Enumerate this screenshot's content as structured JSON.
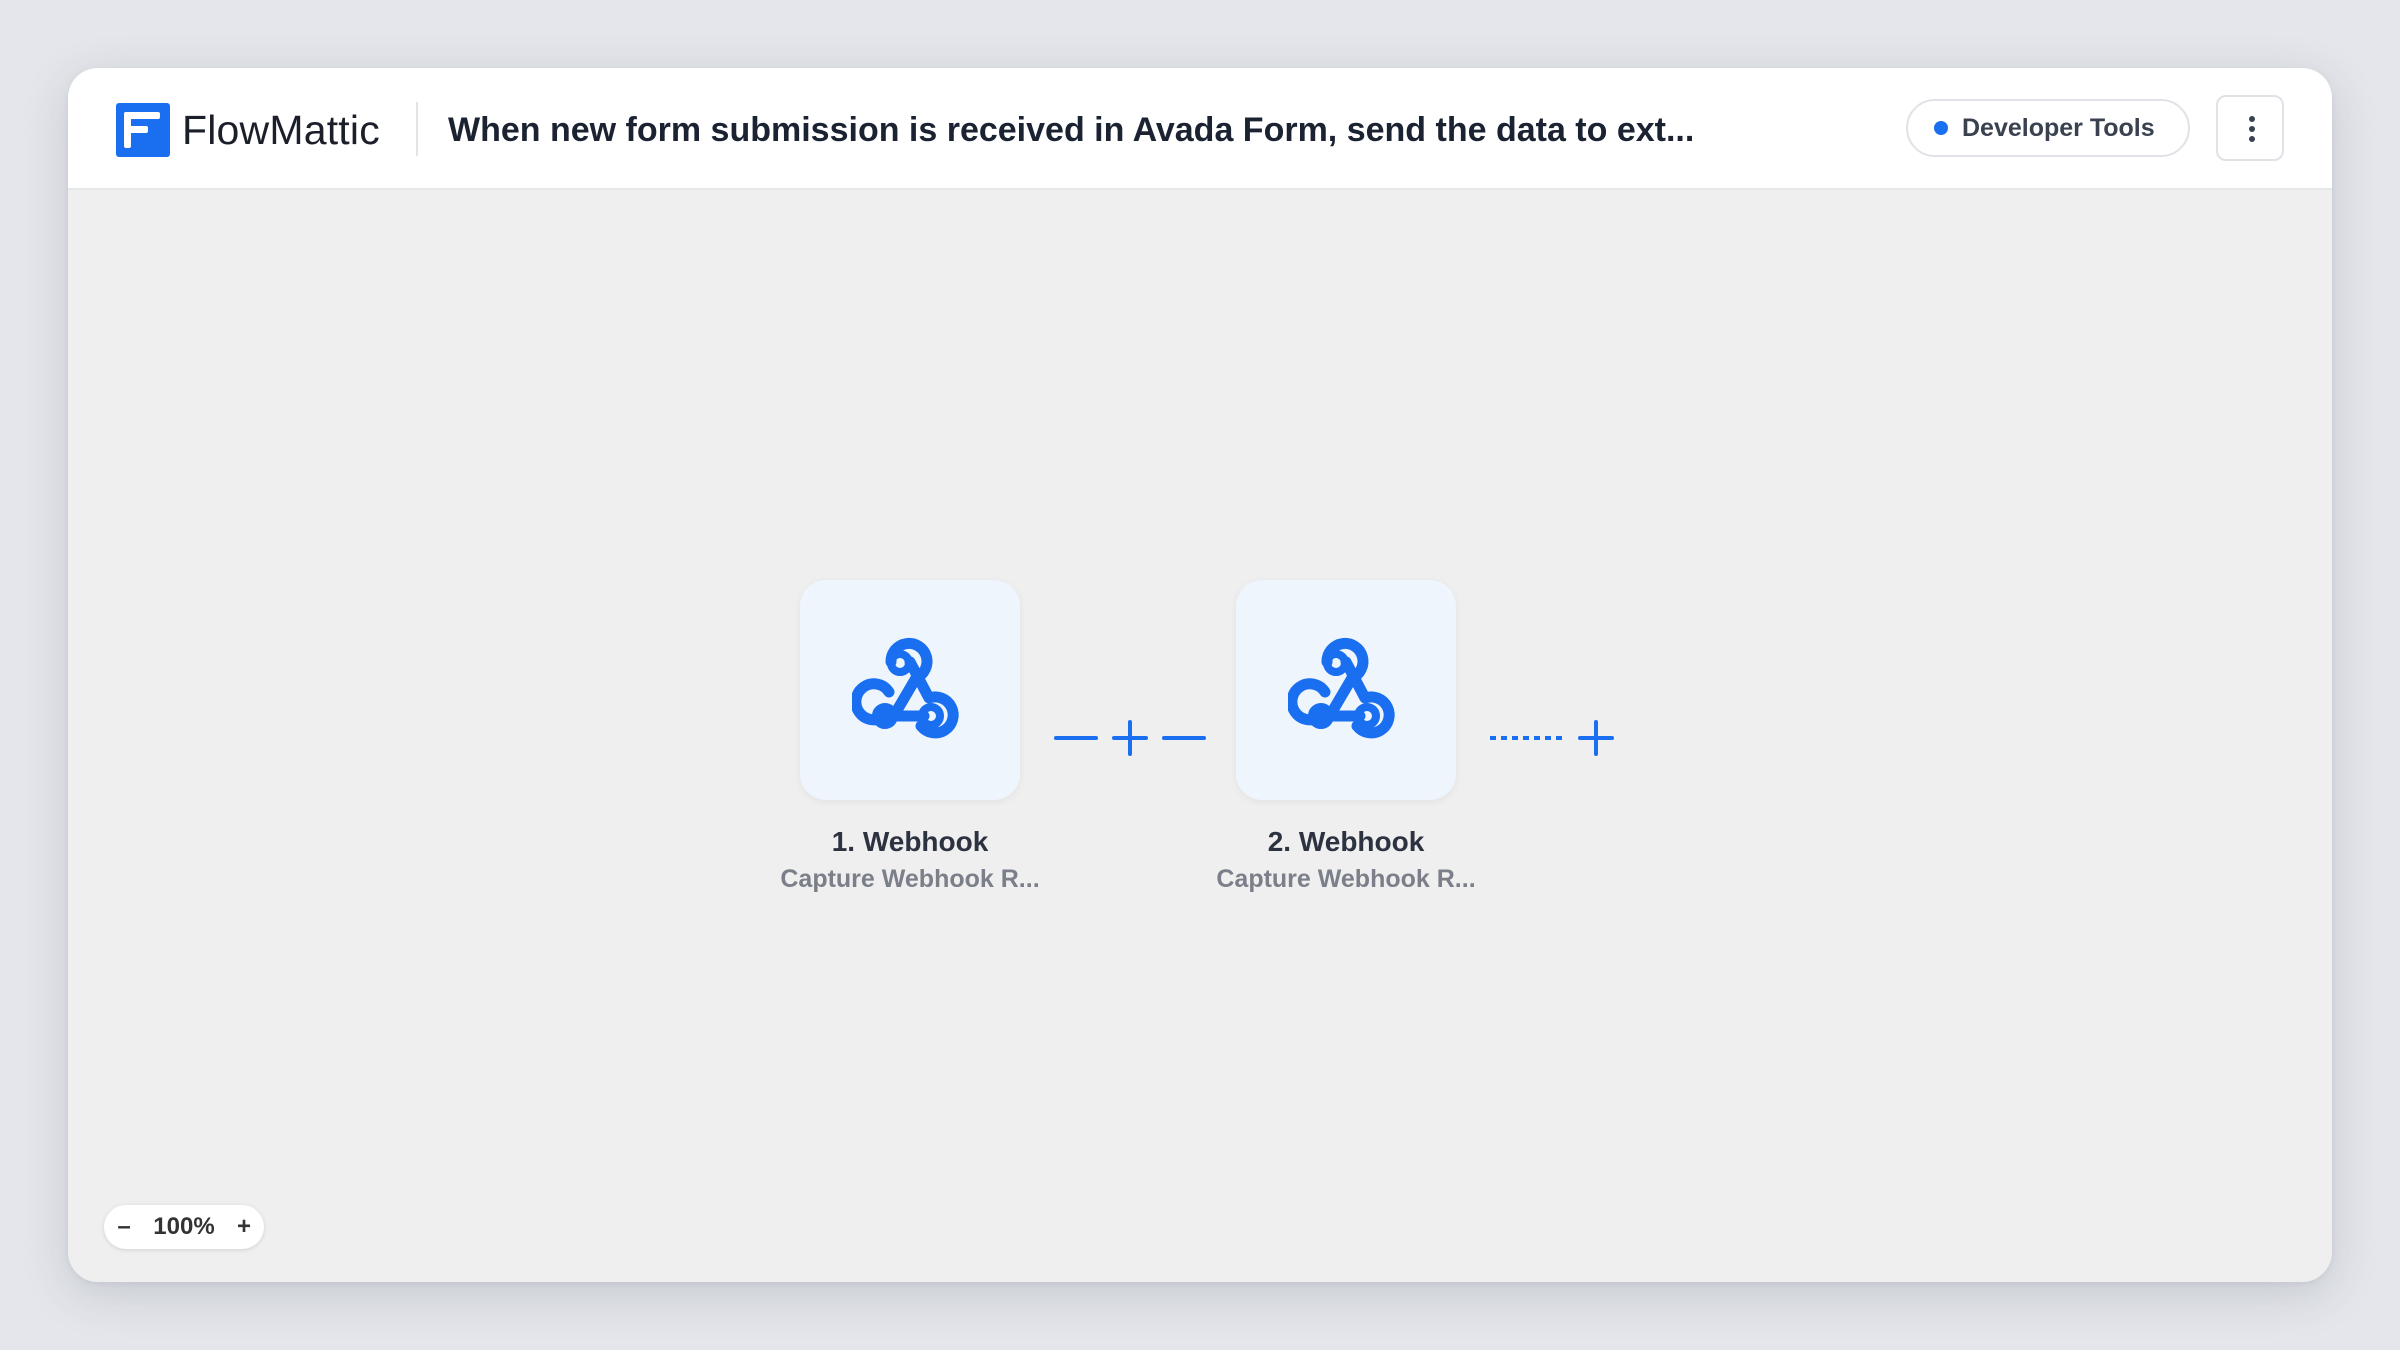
{
  "app": {
    "brand": "FlowMattic",
    "title": "When new form submission is received in Avada Form, send the data to ext...",
    "accent_color": "#1a6ef0"
  },
  "header": {
    "developer_tools_label": "Developer Tools",
    "menu_icon": "more-vertical-icon"
  },
  "workflow": {
    "steps": [
      {
        "title": "1. Webhook",
        "subtitle": "Capture Webhook R...",
        "icon": "webhook-icon"
      },
      {
        "title": "2. Webhook",
        "subtitle": "Capture Webhook R...",
        "icon": "webhook-icon"
      }
    ]
  },
  "zoom": {
    "minus": "–",
    "level": "100%",
    "plus": "+"
  }
}
